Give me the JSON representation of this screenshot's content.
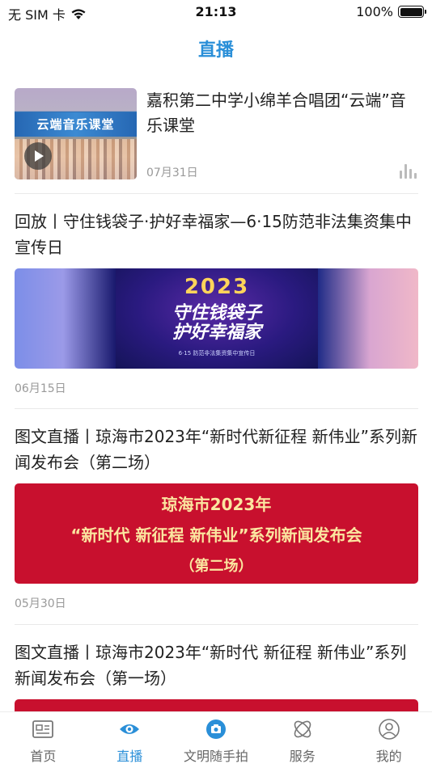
{
  "status_bar": {
    "carrier": "无 SIM 卡",
    "time": "21:13",
    "battery": "100%"
  },
  "header": {
    "title": "直播"
  },
  "feed": [
    {
      "title": "嘉积第二中学小绵羊合唱团“云端”音乐课堂",
      "date": "07月31日",
      "thumb_text": "云端音乐课堂"
    },
    {
      "title": "回放丨守住钱袋子·护好幸福家—6·15防范非法集资集中宣传日",
      "date": "06月15日",
      "image": {
        "year": "2023",
        "slogan_1": "守住钱袋子",
        "slogan_2": "护好幸福家",
        "sub": "6·15 防范非法集资集中宣传日"
      }
    },
    {
      "title": "图文直播丨琼海市2023年“新时代新征程 新伟业”系列新闻发布会（第二场）",
      "date": "05月30日",
      "image": {
        "line1": "琼海市2023年",
        "line2": "“新时代 新征程 新伟业”系列新闻发布会",
        "line3": "（第二场）"
      }
    },
    {
      "title": "图文直播丨琼海市2023年“新时代 新征程 新伟业”系列新闻发布会（第一场）"
    }
  ],
  "tabs": [
    {
      "label": "首页",
      "icon": "newspaper-icon"
    },
    {
      "label": "直播",
      "icon": "eye-icon"
    },
    {
      "label": "文明随手拍",
      "icon": "camera-icon"
    },
    {
      "label": "服务",
      "icon": "orbit-icon"
    },
    {
      "label": "我的",
      "icon": "user-icon"
    }
  ],
  "colors": {
    "accent": "#2a8fd8",
    "muted": "#999999",
    "banner_red": "#c8102e"
  }
}
